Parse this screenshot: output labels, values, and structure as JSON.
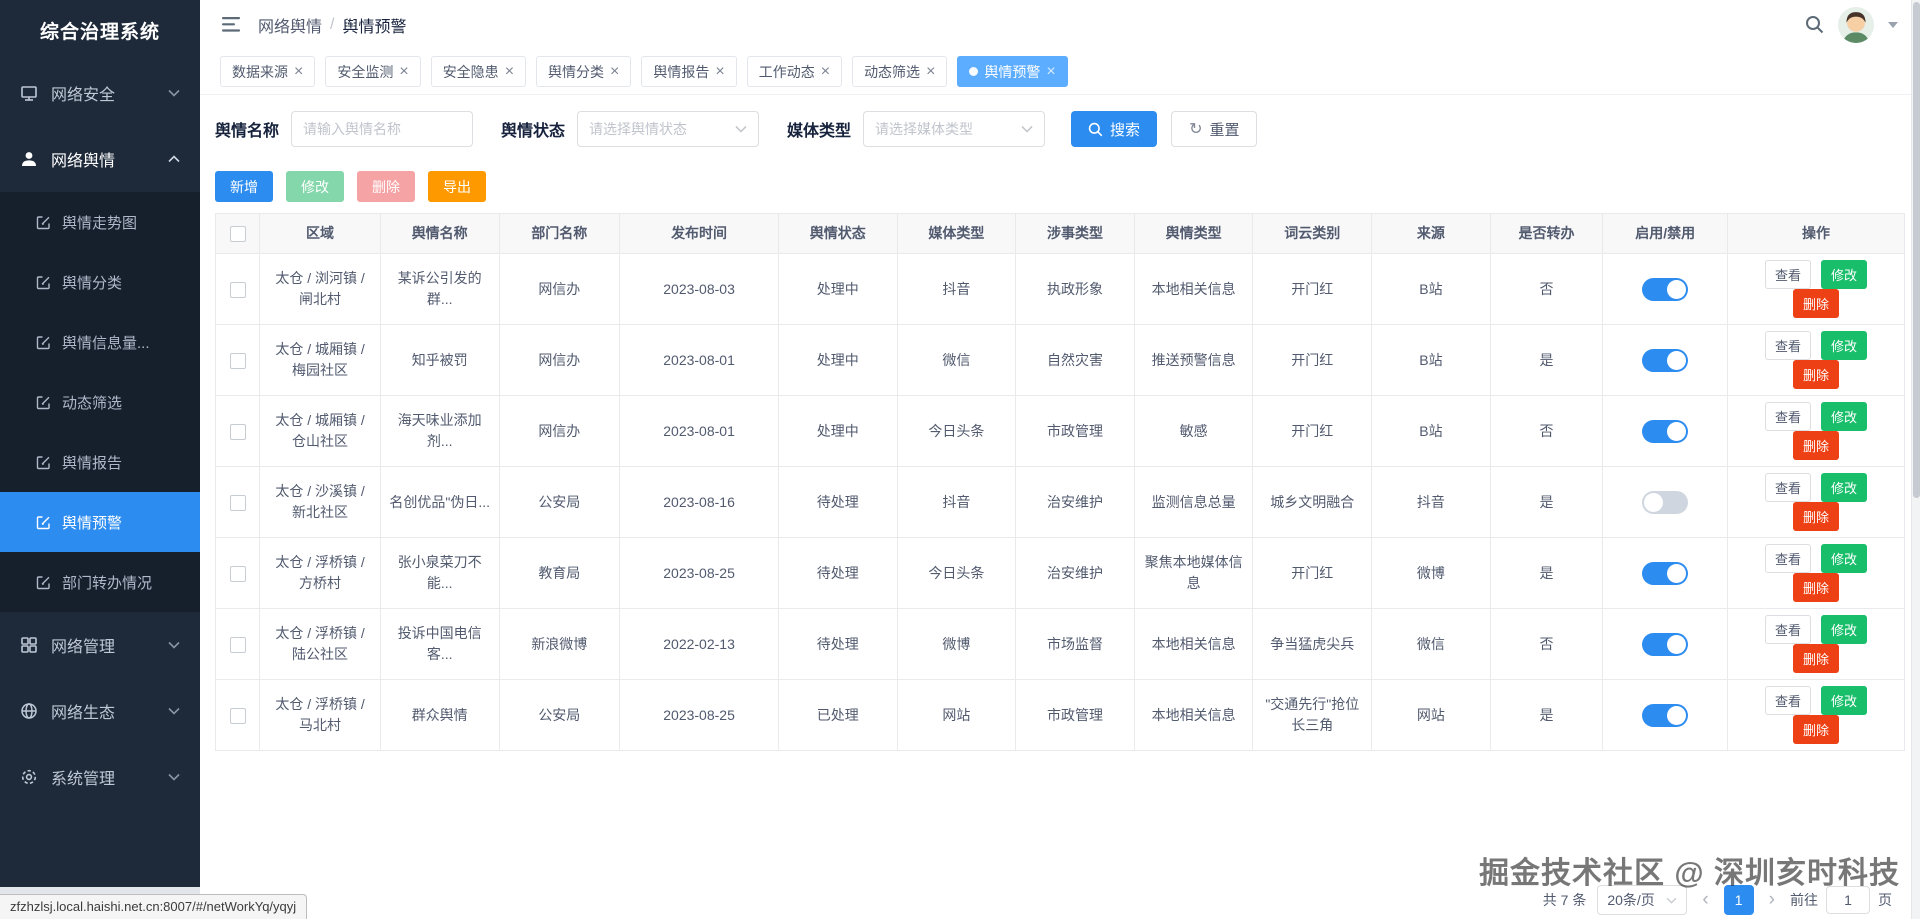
{
  "app": {
    "title": "综合治理系统"
  },
  "header": {
    "breadcrumb": [
      "网络舆情",
      "舆情预警"
    ],
    "separator": "/"
  },
  "icons": {
    "close": "×",
    "prev": "‹",
    "next": "›"
  },
  "sidebar": {
    "sections": [
      {
        "label": "网络安全"
      },
      {
        "label": "网络舆情"
      },
      {
        "label": "网络管理"
      },
      {
        "label": "网络生态"
      },
      {
        "label": "系统管理"
      }
    ],
    "submenu": [
      {
        "label": "舆情走势图"
      },
      {
        "label": "舆情分类"
      },
      {
        "label": "舆情信息量..."
      },
      {
        "label": "动态筛选"
      },
      {
        "label": "舆情报告"
      },
      {
        "label": "舆情预警",
        "active": "true"
      },
      {
        "label": "部门转办情况"
      }
    ]
  },
  "tabs": [
    {
      "label": "数据来源"
    },
    {
      "label": "安全监测"
    },
    {
      "label": "安全隐患"
    },
    {
      "label": "舆情分类"
    },
    {
      "label": "舆情报告"
    },
    {
      "label": "工作动态"
    },
    {
      "label": "动态筛选"
    },
    {
      "label": "舆情预警",
      "active": "true"
    }
  ],
  "filters": {
    "name_label": "舆情名称",
    "name_placeholder": "请输入舆情名称",
    "status_label": "舆情状态",
    "status_placeholder": "请选择舆情状态",
    "media_label": "媒体类型",
    "media_placeholder": "请选择媒体类型",
    "search_label": "搜索",
    "reset_label": "重置",
    "reset_icon": "↻"
  },
  "toolbar": {
    "add": "新增",
    "edit": "修改",
    "delete": "删除",
    "export": "导出"
  },
  "table": {
    "headers": [
      "区域",
      "舆情名称",
      "部门名称",
      "发布时间",
      "舆情状态",
      "媒体类型",
      "涉事类型",
      "舆情类型",
      "词云类别",
      "来源",
      "是否转办",
      "启用/禁用",
      "操作"
    ],
    "row_actions": {
      "view": "查看",
      "edit": "修改",
      "delete": "删除"
    },
    "rows": [
      {
        "region": "太仓 / 浏河镇 / 闸北村",
        "name": "某诉公引发的群...",
        "dept": "网信办",
        "date": "2023-08-03",
        "status": "处理中",
        "media": "抖音",
        "involve": "执政形象",
        "type": "本地相关信息",
        "cloud": "开门红",
        "source": "B站",
        "transfer": "否",
        "enabled": "on"
      },
      {
        "region": "太仓 / 城厢镇 / 梅园社区",
        "name": "知乎被罚",
        "dept": "网信办",
        "date": "2023-08-01",
        "status": "处理中",
        "media": "微信",
        "involve": "自然灾害",
        "type": "推送预警信息",
        "cloud": "开门红",
        "source": "B站",
        "transfer": "是",
        "enabled": "on"
      },
      {
        "region": "太仓 / 城厢镇 / 仓山社区",
        "name": "海天味业添加剂...",
        "dept": "网信办",
        "date": "2023-08-01",
        "status": "处理中",
        "media": "今日头条",
        "involve": "市政管理",
        "type": "敏感",
        "cloud": "开门红",
        "source": "B站",
        "transfer": "否",
        "enabled": "on"
      },
      {
        "region": "太仓 / 沙溪镇 / 新北社区",
        "name": "名创优品\"伪日...",
        "dept": "公安局",
        "date": "2023-08-16",
        "status": "待处理",
        "media": "抖音",
        "involve": "治安维护",
        "type": "监测信息总量",
        "cloud": "城乡文明融合",
        "source": "抖音",
        "transfer": "是",
        "enabled": "off"
      },
      {
        "region": "太仓 / 浮桥镇 / 方桥村",
        "name": "张小泉菜刀不能...",
        "dept": "教育局",
        "date": "2023-08-25",
        "status": "待处理",
        "media": "今日头条",
        "involve": "治安维护",
        "type": "聚焦本地媒体信息",
        "cloud": "开门红",
        "source": "微博",
        "transfer": "是",
        "enabled": "on"
      },
      {
        "region": "太仓 / 浮桥镇 / 陆公社区",
        "name": "投诉中国电信客...",
        "dept": "新浪微博",
        "date": "2022-02-13",
        "status": "待处理",
        "media": "微博",
        "involve": "市场监督",
        "type": "本地相关信息",
        "cloud": "争当猛虎尖兵",
        "source": "微信",
        "transfer": "否",
        "enabled": "on"
      },
      {
        "region": "太仓 / 浮桥镇 / 马北村",
        "name": "群众舆情",
        "dept": "公安局",
        "date": "2023-08-25",
        "status": "已处理",
        "media": "网站",
        "involve": "市政管理",
        "type": "本地相关信息",
        "cloud": "\"交通先行\"抢位长三角",
        "source": "网站",
        "transfer": "是",
        "enabled": "on"
      }
    ]
  },
  "pagination": {
    "total": "共 7 条",
    "page_size": "20条/页",
    "current": "1",
    "goto_label": "前往",
    "goto_value": "1",
    "page_unit": "页"
  },
  "statusbar": {
    "url": "zfzhzlsj.local.haishi.net.cn:8007/#/netWorkYq/yqyj"
  },
  "watermark": "掘金技术社区 @ 深圳亥时科技"
}
